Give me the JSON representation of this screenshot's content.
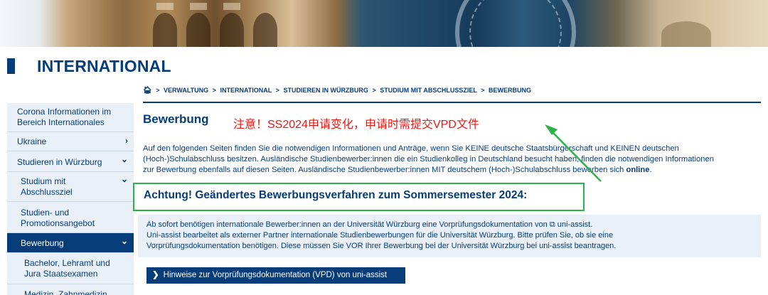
{
  "section_title": "INTERNATIONAL",
  "breadcrumb": {
    "home_icon": "home-icon",
    "items": [
      "VERWALTUNG",
      "INTERNATIONAL",
      "STUDIEREN IN WÜRZBURG",
      "STUDIUM MIT ABSCHLUSSZIEL",
      "BEWERBUNG"
    ],
    "separator": ">"
  },
  "sidebar": {
    "items": [
      {
        "label": "Corona Informationen im Bereich Internationales"
      },
      {
        "label": "Ukraine",
        "chevron": "›"
      },
      {
        "label": "Studieren in Würzburg",
        "chevron": "⌄"
      },
      {
        "label": "Studium mit Abschlussziel",
        "chevron": "⌄"
      },
      {
        "label": "Studien- und Promotionsangebot"
      },
      {
        "label": "Bewerbung",
        "chevron": "⌄"
      },
      {
        "label": "Bachelor, Lehramt und Jura Staatsexamen"
      },
      {
        "label": "Medizin, Zahnmedizin"
      }
    ]
  },
  "main": {
    "title": "Bewerbung",
    "annotation": "注意！SS2024申请变化，申请时需提交VPD文件",
    "intro_lines": [
      "Auf den folgenden Seiten finden Sie die notwendigen Informationen und Anträge, wenn Sie KEINE deutsche Staatsbürgerschaft und KEINEN deutschen",
      "(Hoch-)Schulabschluss besitzen. Ausländische Studienbewerber:innen die ein Studienkolleg in Deutschland besucht haben, finden die notwendigen Informationen",
      "zur Bewerbung ebenfalls auf diesen Seiten. Ausländische Studienbewerber:innen MIT deutschem (Hoch-)Schulabschluss bewerben sich "
    ],
    "intro_link": "online",
    "intro_end": ".",
    "notice_title": "Achtung! Geändertes Bewerbungsverfahren zum Sommersemester 2024:",
    "info": {
      "line1_a": "Ab sofort benötigen internationale Bewerber:innen an der Universität Würzburg eine Vorprüfungsdokumentation von ",
      "line1_b": " uni-assist.",
      "line2": "Uni-assist bearbeitet als externer Partner internationale Studienbewerbungen für die Universität Würzburg.  Bitte prüfen Sie, ob sie eine",
      "line3": "Vorprüfungsdokumentation benötigen. Diese müssen Sie VOR Ihrer Bewerbung bei der Universität Würzburg bei uni-assist beantragen."
    },
    "cta_label": "Hinweise zur Vorprüfungsdokumentation (VPD) von uni-assist"
  },
  "colors": {
    "brand_blue": "#063d79",
    "sidebar_bg": "#e9f0f7",
    "annotation_red": "#e41b17",
    "highlight_green": "#2fb14a"
  }
}
